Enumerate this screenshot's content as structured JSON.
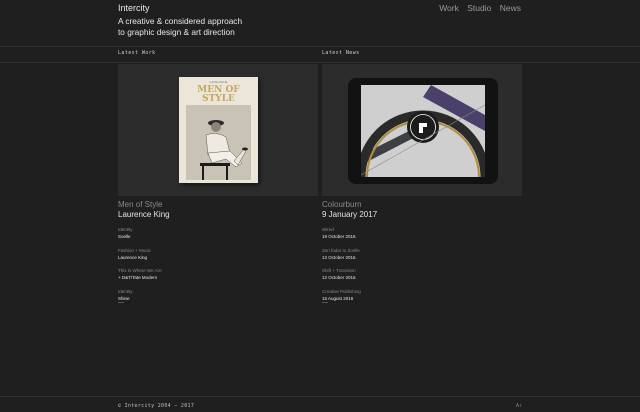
{
  "header": {
    "brand": "Intercity",
    "tagline_line1": "A creative & considered approach",
    "tagline_line2": "to graphic design & art direction",
    "nav": [
      "Work",
      "Studio",
      "News"
    ]
  },
  "latest_work": {
    "label": "Latest Work",
    "book_top": "CATALOGUE",
    "book_title_1": "MEN OF",
    "book_title_2": "STYLE",
    "title": "Men of Style",
    "subtitle": "Laurence King",
    "items": [
      {
        "category": "Identity",
        "name": "Soelle"
      },
      {
        "category": "Fashion + Music",
        "name": "Laurence King"
      },
      {
        "category": "This Is Where We Are",
        "name": "+ D&T/Tate Modern"
      },
      {
        "category": "Identity",
        "name": "Shine"
      }
    ]
  },
  "latest_news": {
    "label": "Latest News",
    "title": "Colourburn",
    "subtitle": "9 January 2017",
    "items": [
      {
        "category": "Wired",
        "name": "19 October 2016"
      },
      {
        "category": "Zen fodar to Zoelle",
        "name": "12 October 2016"
      },
      {
        "category": "Shift + Transition",
        "name": "12 October 2016"
      },
      {
        "category": "Creative Publishing",
        "name": "15 August 2016"
      }
    ]
  },
  "dash": "—",
  "footer": {
    "copyright": "© Intercity 2004 – 2017",
    "right": "A↑"
  },
  "colors": {
    "background": "#1f1f1f",
    "panel": "#2c2c2c",
    "text": "#dcdcdc",
    "muted": "#8a8a8a"
  }
}
